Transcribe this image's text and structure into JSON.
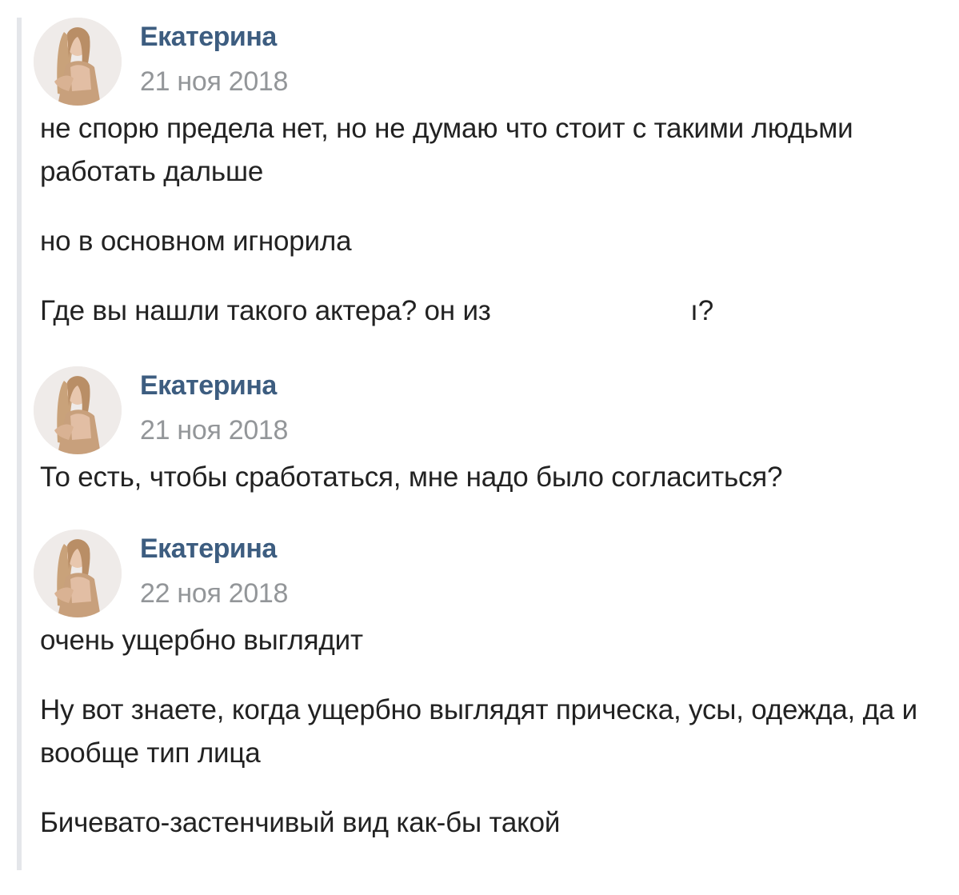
{
  "messages": [
    {
      "author": "Екатерина",
      "date": "21 ноя 2018",
      "paragraphs": [
        "не спорю предела нет, но не думаю что стоит с такими людьми работать дальше",
        "но в основном игнорила"
      ],
      "redacted_paragraph": {
        "before": "Где вы нашли такого актера? он из",
        "after": "ı?"
      }
    },
    {
      "author": "Екатерина",
      "date": "21 ноя 2018",
      "paragraphs": [
        "То есть, чтобы сработаться, мне надо было согласиться?"
      ]
    },
    {
      "author": "Екатерина",
      "date": "22 ноя 2018",
      "paragraphs": [
        "очень ущербно выглядит",
        "Ну вот знаете, когда ущербно выглядят прическа, усы, одежда, да и вообще тип лица",
        "Бичевато-застенчивый вид как-бы такой"
      ]
    }
  ],
  "colors": {
    "author": "#3d5d80",
    "date": "#939699",
    "text": "#222222",
    "quote_bar": "#e4e6ea"
  },
  "icons": {
    "avatar": "user-photo-avatar"
  }
}
